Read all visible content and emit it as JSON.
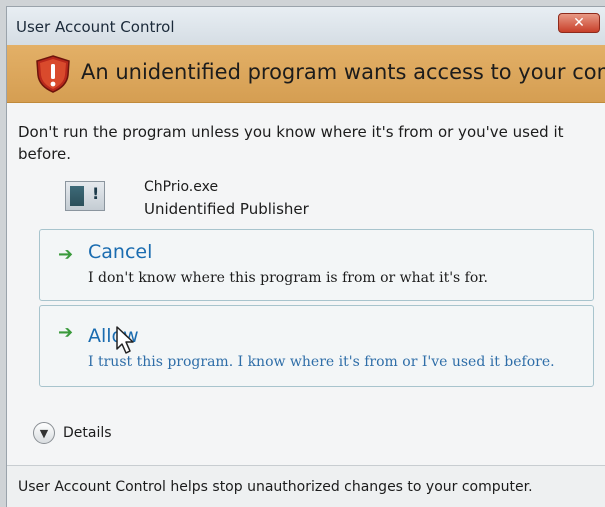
{
  "window": {
    "title": "User Account Control",
    "close_symbol": "✕"
  },
  "banner": {
    "icon": "shield-warning-icon",
    "text": "An unidentified program wants access to your computer"
  },
  "message": "Don't run the program unless you know where it's from or you've used it before.",
  "program": {
    "icon": "program-icon",
    "name": "ChPrio.exe",
    "publisher": "Unidentified Publisher"
  },
  "options": [
    {
      "title": "Cancel",
      "description": "I don't know where this program is from or what it's for."
    },
    {
      "title": "Allow",
      "description": "I trust this program. I know where it's from or I've used it before."
    }
  ],
  "details": {
    "label": "Details",
    "icon": "chevron-down-icon"
  },
  "footer": "User Account Control helps stop unauthorized changes to your computer.",
  "colors": {
    "banner": "#dca35b",
    "link": "#1a6cb0",
    "arrow": "#3a9a3c",
    "close": "#c8402a"
  }
}
